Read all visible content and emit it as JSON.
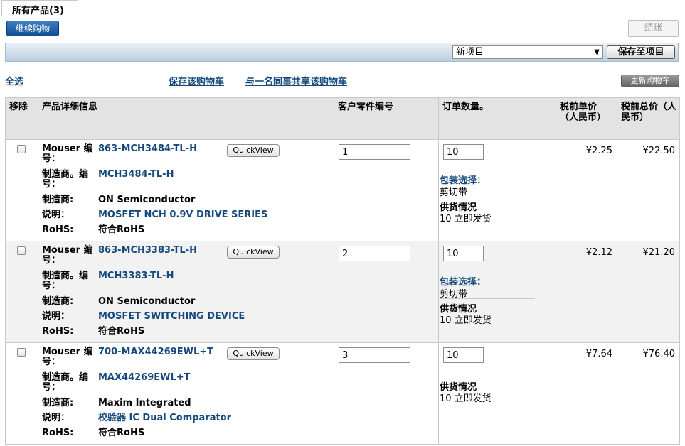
{
  "tab": {
    "label": "所有产品(3)"
  },
  "toolbar": {
    "continue_label": "继续购物",
    "checkout_label": "结账"
  },
  "project": {
    "selected": "新项目",
    "save_label": "保存至项目"
  },
  "links": {
    "select_all": "全选",
    "save_cart": "保存该购物车",
    "share_cart": "与一名同事共享该购物车",
    "update_cart": "更新购物车"
  },
  "table": {
    "headers": {
      "remove": "移除",
      "details": "产品详细信息",
      "customer_pn": "客户零件编号",
      "qty": "订单数量。",
      "unit_price": "税前单价（人民币）",
      "total_price": "税前总价（人民币）"
    },
    "labels": {
      "mouser_no": "Mouser 编号：",
      "mfr_no": "制造商。编号：",
      "mfr": "制造商:",
      "desc": "说明：",
      "rohs": "RoHS:",
      "quickview": "QuickView",
      "packaging": "包装选择：",
      "availability": "供货情况"
    },
    "rows": [
      {
        "mouser_no": "863-MCH3484-TL-H",
        "mfr_no": "MCH3484-TL-H",
        "mfr": "ON Semiconductor",
        "desc": "MOSFET NCH 0.9V DRIVE SERIES",
        "rohs": "符合RoHS",
        "customer_pn": "1",
        "qty": "10",
        "packaging": "剪切带",
        "availability": "10 立即发货",
        "unit_price": "¥2.25",
        "total_price": "¥22.50"
      },
      {
        "mouser_no": "863-MCH3383-TL-H",
        "mfr_no": "MCH3383-TL-H",
        "mfr": "ON Semiconductor",
        "desc": "MOSFET SWITCHING DEVICE",
        "rohs": "符合RoHS",
        "customer_pn": "2",
        "qty": "10",
        "packaging": "剪切带",
        "availability": "10 立即发货",
        "unit_price": "¥2.12",
        "total_price": "¥21.20"
      },
      {
        "mouser_no": "700-MAX44269EWL+T",
        "mfr_no": "MAX44269EWL+T",
        "mfr": "Maxim Integrated",
        "desc": "校验器 IC Dual Comparator",
        "rohs": "符合RoHS",
        "customer_pn": "3",
        "qty": "10",
        "availability": "10 立即发货",
        "unit_price": "¥7.64",
        "total_price": "¥76.40"
      }
    ]
  }
}
